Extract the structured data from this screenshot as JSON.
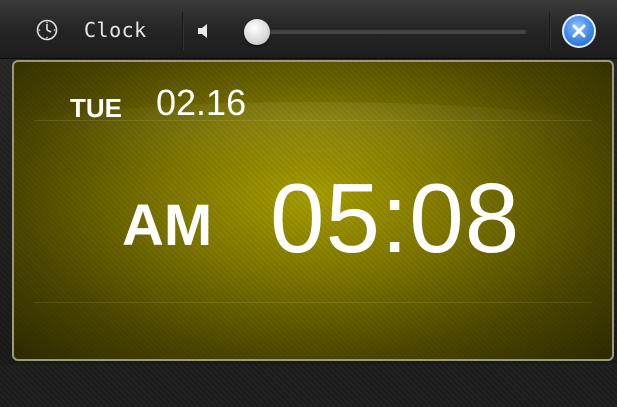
{
  "window": {
    "title": "Clock",
    "icons": {
      "app": "clock-icon",
      "volume": "speaker-icon",
      "close": "close-icon"
    },
    "volume_level": 0.02
  },
  "display": {
    "day": "TUE",
    "date": "02.16",
    "meridiem": "AM",
    "time": "05:08"
  },
  "colors": {
    "panel_accent": "#8a8200",
    "close_button": "#3d87e6"
  }
}
